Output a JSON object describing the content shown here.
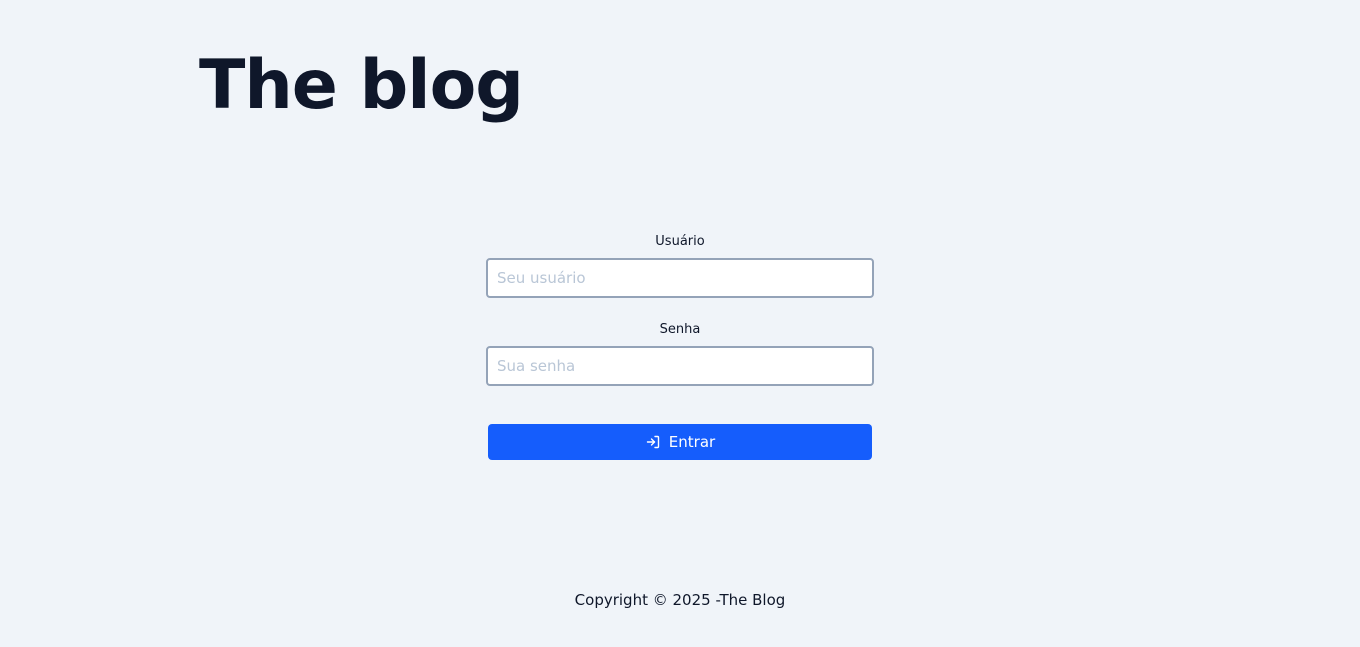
{
  "header": {
    "title": "The blog"
  },
  "login": {
    "username": {
      "label": "Usuário",
      "placeholder": "Seu usuário",
      "value": ""
    },
    "password": {
      "label": "Senha",
      "placeholder": "Sua senha",
      "value": ""
    },
    "submit": {
      "label": "Entrar",
      "icon": "log-in-icon"
    }
  },
  "footer": {
    "text": "Copyright © 2025 -The Blog"
  },
  "colors": {
    "background": "#f0f4f9",
    "text": "#0f172a",
    "accent": "#155dfc",
    "input_border": "#94a3b8"
  }
}
